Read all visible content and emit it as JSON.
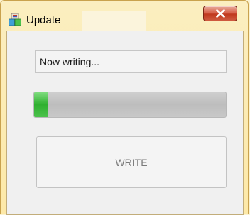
{
  "window": {
    "title": "Update",
    "app_icon": "update-app-icon",
    "close_icon": "close-icon"
  },
  "status": {
    "text": "Now writing..."
  },
  "progress": {
    "fraction": 0.07
  },
  "buttons": {
    "write_label": "WRITE",
    "write_enabled": false
  },
  "colors": {
    "frame": "#fde9a8",
    "progress_fill": "#2fb02f",
    "close_button": "#c0391f"
  }
}
